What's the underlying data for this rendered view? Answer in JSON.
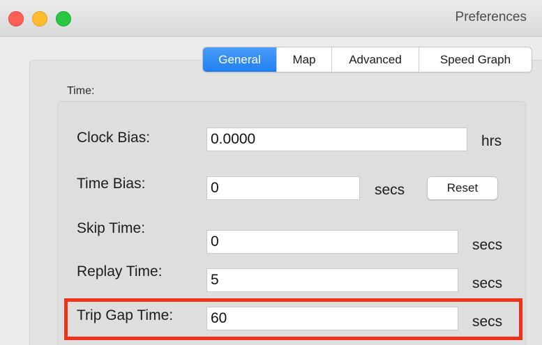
{
  "window": {
    "title": "Preferences"
  },
  "tabs": [
    {
      "label": "General",
      "active": true
    },
    {
      "label": "Map",
      "active": false
    },
    {
      "label": "Advanced",
      "active": false
    },
    {
      "label": "Speed Graph",
      "active": false
    }
  ],
  "time_section": {
    "label": "Time:",
    "clock_bias": {
      "label": "Clock Bias:",
      "value": "0.0000",
      "unit": "hrs"
    },
    "time_bias": {
      "label": "Time Bias:",
      "value": "0",
      "unit": "secs",
      "reset_label": "Reset"
    },
    "skip_time": {
      "label": "Skip Time:",
      "value": "0",
      "unit": "secs"
    },
    "replay_time": {
      "label": "Replay Time:",
      "value": "5",
      "unit": "secs"
    },
    "trip_gap_time": {
      "label": "Trip Gap Time:",
      "value": "60",
      "unit": "secs"
    }
  },
  "colors": {
    "accent_tab": "#1f7ef0",
    "highlight": "#f0321b",
    "close": "#fe5f57",
    "minimize": "#febc2e",
    "maximize": "#28c840"
  }
}
